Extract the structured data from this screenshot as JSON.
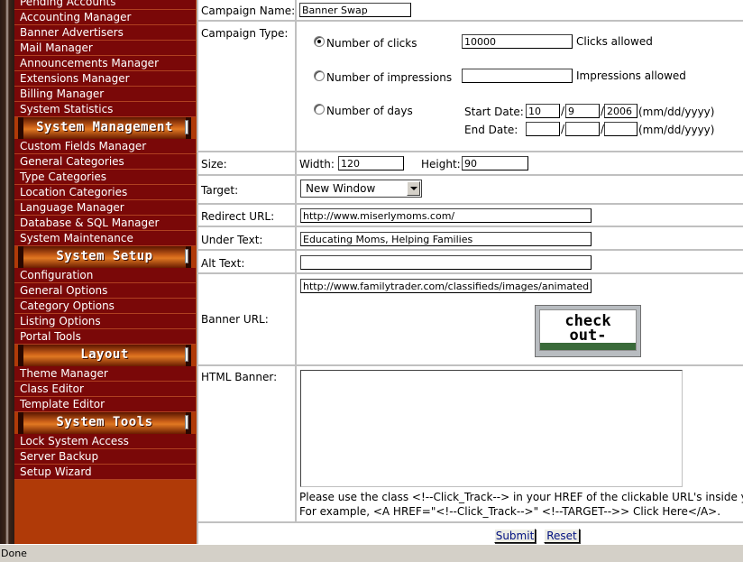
{
  "sidebar": {
    "items_top": [
      "Pending Accounts",
      "Accounting Manager",
      "Banner Advertisers",
      "Mail Manager",
      "Announcements Manager",
      "Extensions Manager",
      "Billing Manager",
      "System Statistics"
    ],
    "sections": [
      {
        "title": "System Management",
        "items": [
          "Custom Fields Manager",
          "General Categories",
          "Type Categories",
          "Location Categories",
          "Language Manager",
          "Database & SQL Manager",
          "System Maintenance"
        ]
      },
      {
        "title": "System Setup",
        "items": [
          "Configuration",
          "General Options",
          "Category Options",
          "Listing Options",
          "Portal Tools"
        ]
      },
      {
        "title": "Layout",
        "items": [
          "Theme Manager",
          "Class Editor",
          "Template Editor"
        ]
      },
      {
        "title": "System Tools",
        "items": [
          "Lock System Access",
          "Server Backup",
          "Setup Wizard"
        ]
      }
    ]
  },
  "form": {
    "campaign_name": {
      "label": "Campaign Name:",
      "value": "Banner Swap"
    },
    "campaign_type": {
      "label": "Campaign Type:",
      "clicks": {
        "label": "Number of clicks",
        "value": "10000",
        "suffix": "Clicks allowed",
        "selected": true
      },
      "impressions": {
        "label": "Number of impressions",
        "value": "",
        "suffix": "Impressions allowed"
      },
      "days": {
        "label": "Number of days",
        "start_label": "Start Date:",
        "start_mm": "10",
        "start_dd": "9",
        "start_yyyy": "2006",
        "end_label": "End Date:",
        "end_mm": "",
        "end_dd": "",
        "end_yyyy": "",
        "format": "(mm/dd/yyyy)",
        "sep": "/"
      }
    },
    "size": {
      "label": "Size:",
      "width_label": "Width:",
      "width": "120",
      "height_label": "Height:",
      "height": "90"
    },
    "target": {
      "label": "Target:",
      "value": "New Window"
    },
    "redirect_url": {
      "label": "Redirect URL:",
      "value": "http://www.miserlymoms.com/"
    },
    "under_text": {
      "label": "Under Text:",
      "value": "Educating Moms, Helping Families"
    },
    "alt_text": {
      "label": "Alt Text:",
      "value": ""
    },
    "banner_url": {
      "label": "Banner URL:",
      "value": "http://www.familytrader.com/classifieds/images/animatedr",
      "preview_text_1": "check",
      "preview_text_2": "out-"
    },
    "html_banner": {
      "label": "HTML Banner:",
      "value": "",
      "help_1": "Please use the class <!--Click_Track--> in your HREF of the clickable URL's inside your",
      "help_2": "For example, <A HREF=\"<!--Click_Track-->\" <!--TARGET-->> Click Here</A>."
    },
    "submit_label": "Submit",
    "reset_label": "Reset"
  },
  "status": {
    "text": "Done"
  }
}
